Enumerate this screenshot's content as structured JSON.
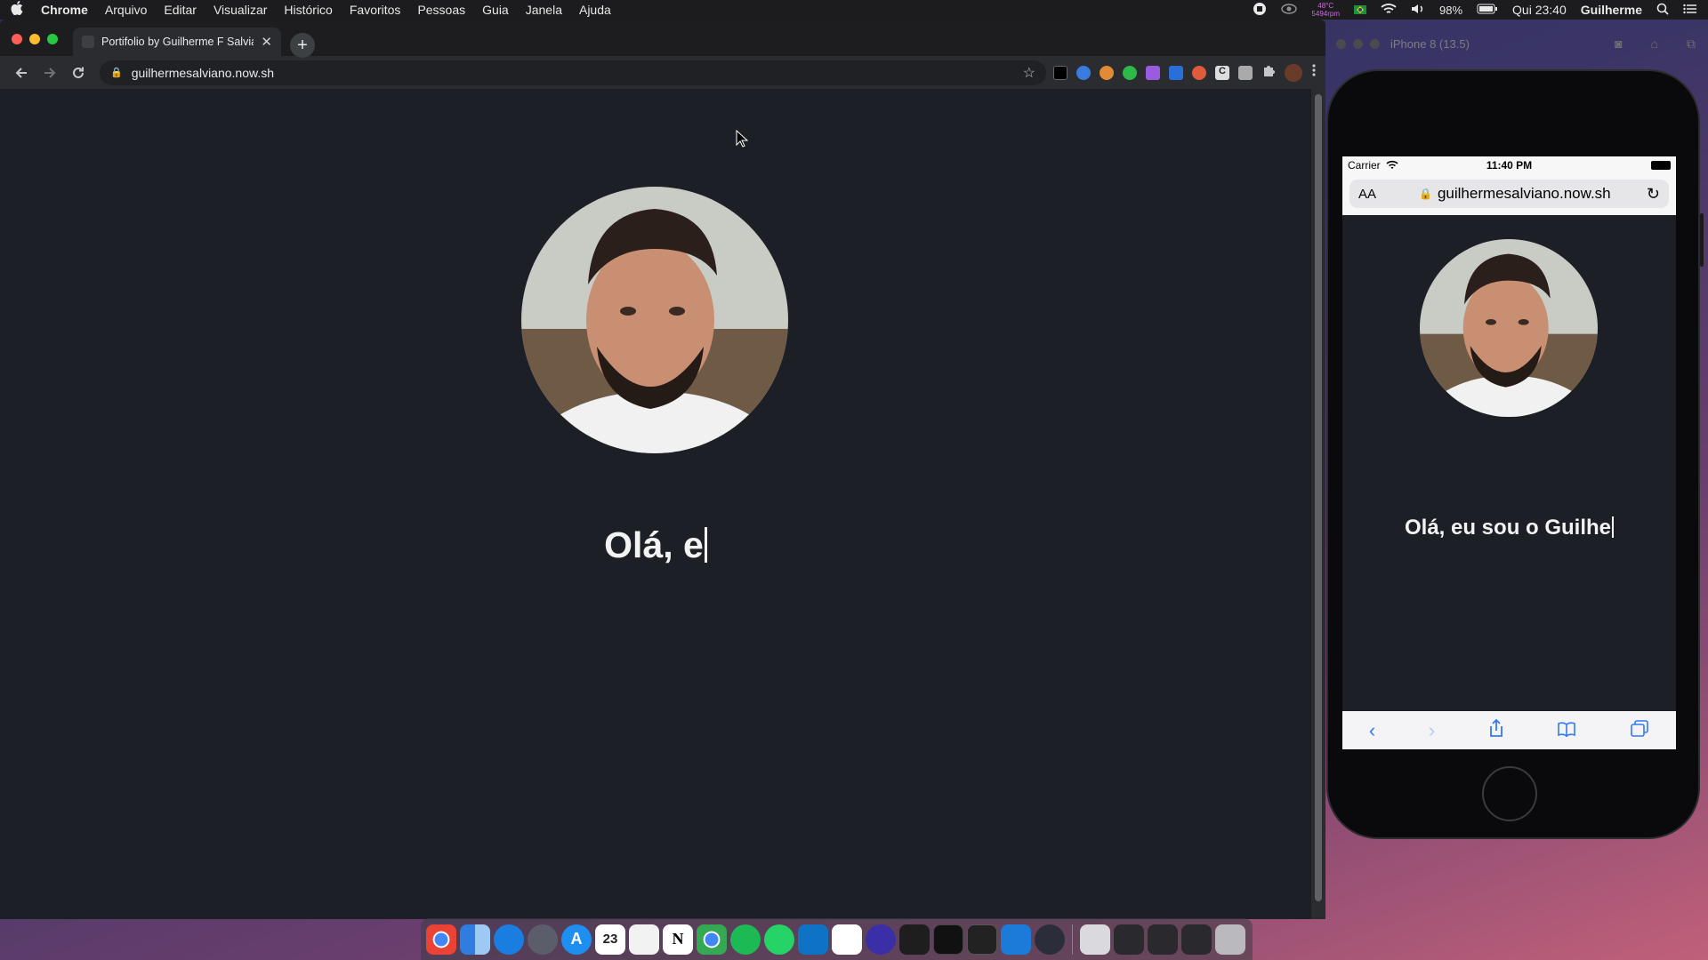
{
  "menubar": {
    "app": "Chrome",
    "items": [
      "Arquivo",
      "Editar",
      "Visualizar",
      "Histórico",
      "Favoritos",
      "Pessoas",
      "Guia",
      "Janela",
      "Ajuda"
    ],
    "temp": "48°C",
    "fan": "5494rpm",
    "battery": "98%",
    "clock": "Qui 23:40",
    "user": "Guilherme"
  },
  "chrome": {
    "tab_title": "Portifolio by Guilherme F Salviano",
    "url": "guilhermesalviano.now.sh",
    "page": {
      "heading_typed": "Olá, e",
      "bg_color": "#1d1f26"
    }
  },
  "simulator": {
    "title": "iPhone 8 (13.5)",
    "status_carrier": "Carrier",
    "status_time": "11:40 PM",
    "url_aa": "AA",
    "url": "guilhermesalviano.now.sh",
    "heading_typed": "Olá, eu sou o Guilhe"
  },
  "dock": {
    "items": [
      "chrome-icon",
      "finder-icon",
      "safari-icon",
      "launchpad-icon",
      "appstore-icon",
      "calendar-icon",
      "pages-icon",
      "notion-icon",
      "chrome-icon",
      "spotify-icon",
      "whatsapp-icon",
      "vscode-icon",
      "slack-icon",
      "orbit-icon",
      "figma-icon",
      "terminal-icon",
      "iterm-icon",
      "xcode-icon",
      "electron-icon"
    ],
    "calendar_day": "23",
    "notion_letter": "N"
  }
}
